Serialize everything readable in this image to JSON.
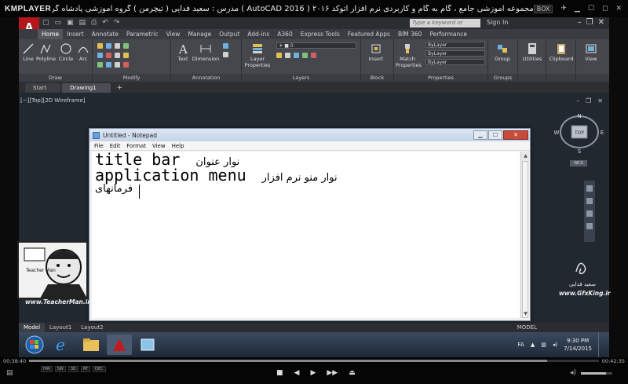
{
  "player": {
    "logo": "KMPLAYER",
    "title": "مجموعه آموزشی جامع ، گام به گام و کاربردی نرم افزار  اتوکد ۲۰۱۶ ( 2016 AutoCAD )  مدرس : سعید فدایی ( تیچرمن ) گروه آموزشی پادشاه گرافیست ها",
    "mode_badge": "BOX",
    "time_elapsed": "00:38:40",
    "time_total": "00:42:35",
    "seek_progress": 0.91,
    "volume": 0.8,
    "small_buttons": [
      "HW",
      "SW",
      "3D",
      "RT",
      "DEC"
    ]
  },
  "autocad": {
    "logo": "A",
    "search_placeholder": "Type a keyword or phrase",
    "sign_in": "Sign In",
    "ribbon_tabs": [
      {
        "label": "Home",
        "active": true
      },
      {
        "label": "Insert",
        "active": false
      },
      {
        "label": "Annotate",
        "active": false
      },
      {
        "label": "Parametric",
        "active": false
      },
      {
        "label": "View",
        "active": false
      },
      {
        "label": "Manage",
        "active": false
      },
      {
        "label": "Output",
        "active": false
      },
      {
        "label": "Add-ins",
        "active": false
      },
      {
        "label": "A360",
        "active": false
      },
      {
        "label": "Express Tools",
        "active": false
      },
      {
        "label": "Featured Apps",
        "active": false
      },
      {
        "label": "BIM 360",
        "active": false
      },
      {
        "label": "Performance",
        "active": false
      }
    ],
    "panels": {
      "draw": {
        "title": "Draw",
        "buttons": [
          "Line",
          "Polyline",
          "Circle",
          "Arc"
        ]
      },
      "modify": {
        "title": "Modify"
      },
      "annotation": {
        "title": "Annotation",
        "buttons": [
          "Text",
          "Dimension"
        ]
      },
      "layers": {
        "title": "Layers",
        "buttons": [
          "Layer Properties"
        ]
      },
      "block": {
        "title": "Block",
        "buttons": [
          "Insert"
        ]
      },
      "properties": {
        "title": "Properties",
        "buttons": [
          "Match Properties"
        ],
        "bylayer": "ByLayer"
      },
      "groups": {
        "title": "Groups",
        "buttons": [
          "Group"
        ]
      },
      "utilities": {
        "title": "",
        "buttons": [
          "Utilities"
        ]
      },
      "clipboard": {
        "title": "",
        "buttons": [
          "Clipboard"
        ]
      },
      "view": {
        "title": "",
        "buttons": [
          "View"
        ]
      }
    },
    "doc_tabs": [
      {
        "label": "Start",
        "active": false
      },
      {
        "label": "Drawing1",
        "active": true
      }
    ],
    "viewport_label": "[−][Top][2D Wireframe]",
    "viewcube": {
      "top": "TOP",
      "n": "N",
      "s": "S",
      "e": "E",
      "w": "W",
      "wcs": "WCS"
    },
    "layout_tabs": [
      "Model",
      "Layout1",
      "Layout2"
    ],
    "status_model": "MODEL"
  },
  "notepad": {
    "title": "Untitled - Notepad",
    "menu": [
      "File",
      "Edit",
      "Format",
      "View",
      "Help"
    ],
    "lines": [
      {
        "en": "title bar",
        "fa": "نوار عنوان"
      },
      {
        "en": "application menu",
        "fa": "نوار منو نرم افزار"
      },
      {
        "en": "",
        "fa": "فرمانهای"
      }
    ]
  },
  "watermark": {
    "badge_url": "www.TeacherMan.ir",
    "badge_text": "Teacher Man",
    "author": "سعید فدایی",
    "site": "www.GfxKing.ir"
  },
  "taskbar": {
    "lang": "FA",
    "time": "9:30 PM",
    "date": "7/14/2015"
  }
}
